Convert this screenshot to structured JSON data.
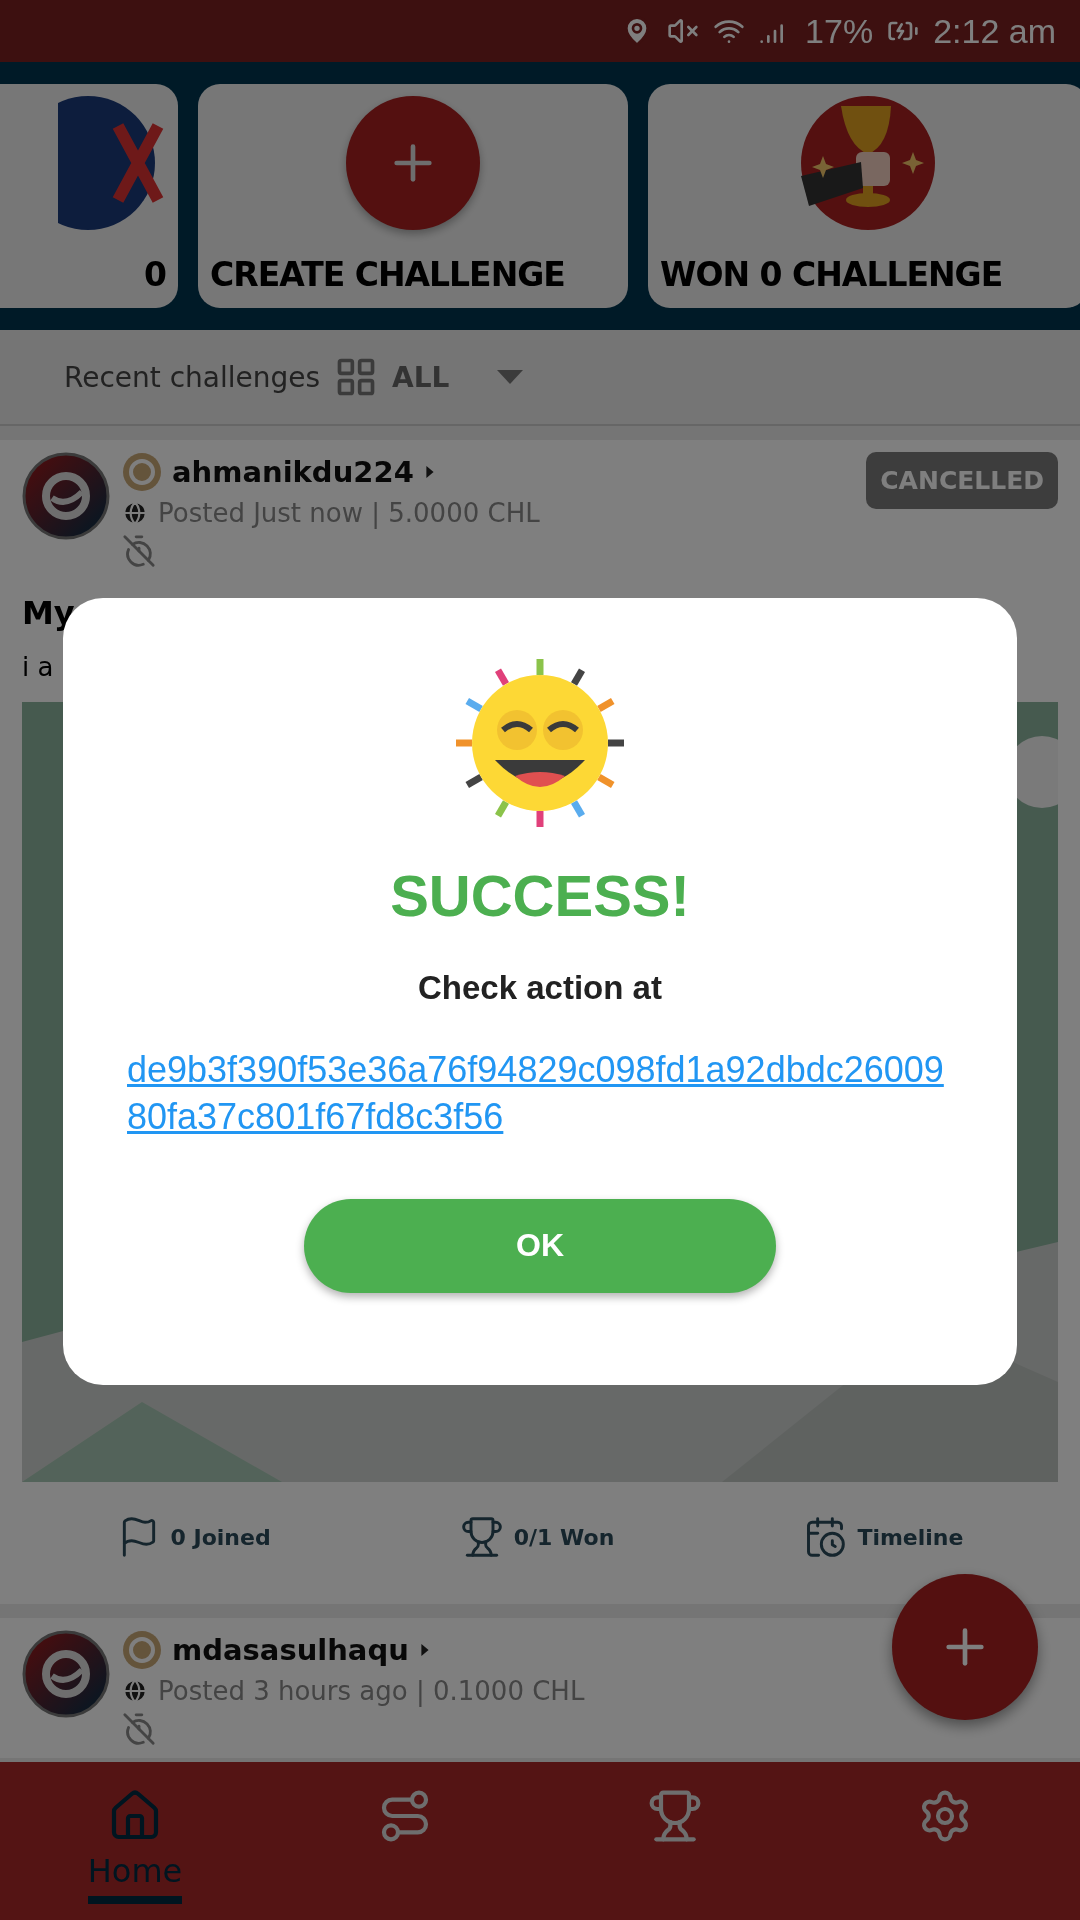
{
  "status_bar": {
    "battery": "17%",
    "time": "2:12 am"
  },
  "summary_cards": [
    {
      "kind": "partial",
      "label": "0"
    },
    {
      "kind": "create",
      "label": "CREATE CHALLENGE"
    },
    {
      "kind": "trophy",
      "label": "WON 0 CHALLENGE"
    }
  ],
  "filter": {
    "label": "Recent challenges",
    "value": "ALL"
  },
  "posts": [
    {
      "username": "ahmanikdu224",
      "meta": "Posted Just now | 5.0000 CHL",
      "status": "CANCELLED",
      "title": "My",
      "body": "i a",
      "actions": [
        {
          "kind": "flag",
          "label": "0 Joined"
        },
        {
          "kind": "trophy",
          "label": "0/1 Won"
        },
        {
          "kind": "calendar",
          "label": "Timeline"
        }
      ]
    },
    {
      "username": "mdasasulhaqu",
      "meta": "Posted 3 hours ago | 0.1000 CHL"
    }
  ],
  "dialog": {
    "title": "SUCCESS!",
    "message": "Check action at",
    "link": "de9b3f390f53e36a76f94829c098fd1a92dbdc2600980fa37c801f67fd8c3f56",
    "button": "OK"
  },
  "nav": [
    {
      "kind": "home",
      "label": "Home",
      "selected": true
    },
    {
      "kind": "route",
      "selected": false
    },
    {
      "kind": "trophy",
      "selected": false
    },
    {
      "kind": "settings",
      "selected": false
    }
  ]
}
